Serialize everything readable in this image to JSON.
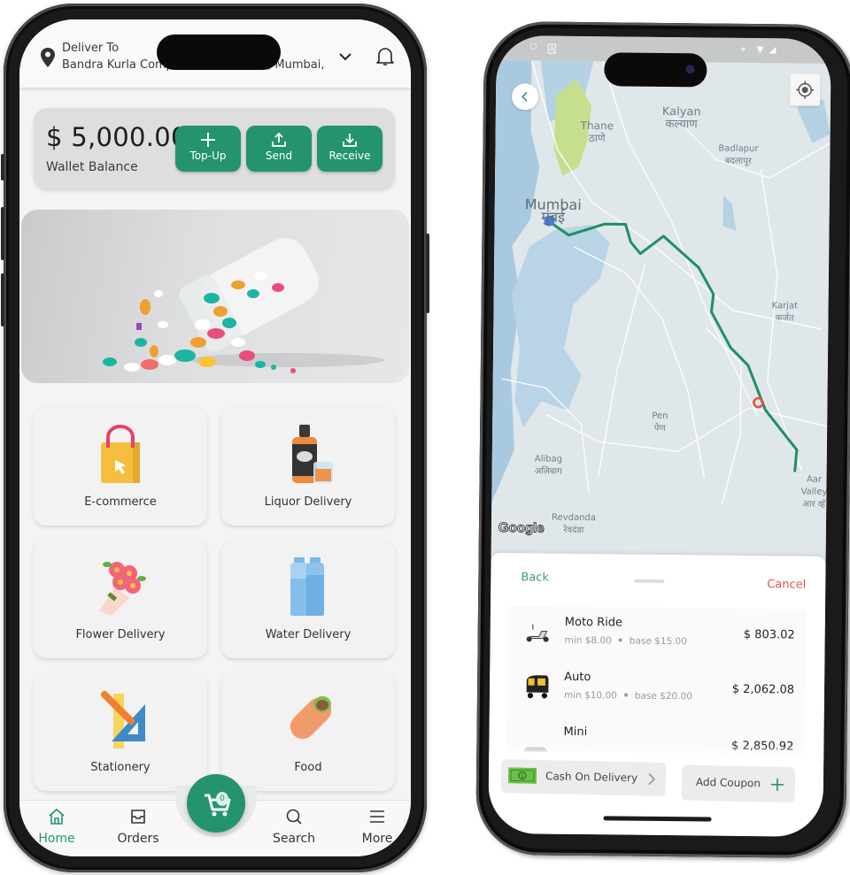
{
  "home_app": {
    "header": {
      "deliver_label": "Deliver To",
      "address": "Bandra Kurla Complex, Bandra East, Mumbai, Ma...",
      "location_icon": "map-pin-icon",
      "dropdown_icon": "chevron-down-icon",
      "notification_icon": "bell-icon"
    },
    "wallet": {
      "amount": "$ 5,000.00",
      "label": "Wallet Balance",
      "actions": [
        {
          "label": "Top-Up",
          "icon": "plus-icon"
        },
        {
          "label": "Send",
          "icon": "upload-icon"
        },
        {
          "label": "Receive",
          "icon": "download-icon"
        }
      ]
    },
    "banner": {
      "subject": "spilled colorful pills from bottle"
    },
    "services": [
      {
        "label": "E-commerce",
        "icon": "shopping-bag-icon"
      },
      {
        "label": "Liquor Delivery",
        "icon": "liquor-bottle-icon"
      },
      {
        "label": "Flower Delivery",
        "icon": "flower-bouquet-icon"
      },
      {
        "label": "Water Delivery",
        "icon": "water-bottles-icon"
      },
      {
        "label": "Stationery",
        "icon": "ruler-pencil-icon"
      },
      {
        "label": "Food",
        "icon": "burrito-icon"
      }
    ],
    "bottom_nav": {
      "items": [
        {
          "label": "Home",
          "icon": "home-icon",
          "active": true
        },
        {
          "label": "Orders",
          "icon": "inbox-icon",
          "active": false
        },
        {
          "label": "Search",
          "icon": "search-icon",
          "active": false
        },
        {
          "label": "More",
          "icon": "menu-icon",
          "active": false
        }
      ],
      "cart_count": "0"
    },
    "accent_color": "#23946b"
  },
  "ride_app": {
    "status_bar": {
      "left_icons": [
        "shield-icon",
        "a-icon"
      ],
      "right_icons": [
        "location-icon",
        "wifi-icon",
        "signal-icon"
      ]
    },
    "map": {
      "labels": [
        {
          "en": "Thane",
          "local": "ठाणे"
        },
        {
          "en": "Kalyan",
          "local": "कल्याण"
        },
        {
          "en": "Badlapur",
          "local": "बदलापूर"
        },
        {
          "en": "Mumbai",
          "local": "मुंबई"
        },
        {
          "en": "Karjat",
          "local": "कर्जत"
        },
        {
          "en": "Pen",
          "local": "पेण"
        },
        {
          "en": "Alibag",
          "local": "अलिबाग"
        },
        {
          "en": "Revdanda",
          "local": "रेवदंडा"
        },
        {
          "en": "Aar Valley",
          "local": "आर व्हॅ"
        }
      ],
      "attribution": "Google",
      "route_color": "#1f8f62",
      "origin_color": "#4a7de8",
      "destination_color": "#e5533f"
    },
    "sheet": {
      "back_label": "Back",
      "cancel_label": "Cancel",
      "rides": [
        {
          "name": "Moto Ride",
          "min": "min $8.00",
          "base": "base $15.00",
          "price": "$ 803.02",
          "icon": "scooter-icon"
        },
        {
          "name": "Auto",
          "min": "min $10.00",
          "base": "base $20.00",
          "price": "$ 2,062.08",
          "icon": "auto-rickshaw-icon"
        },
        {
          "name": "Mini",
          "min": "",
          "base": "",
          "price": "$ 2,850.92",
          "icon": "car-icon"
        }
      ],
      "payment_label": "Cash On Delivery",
      "coupon_label": "Add Coupon"
    }
  }
}
